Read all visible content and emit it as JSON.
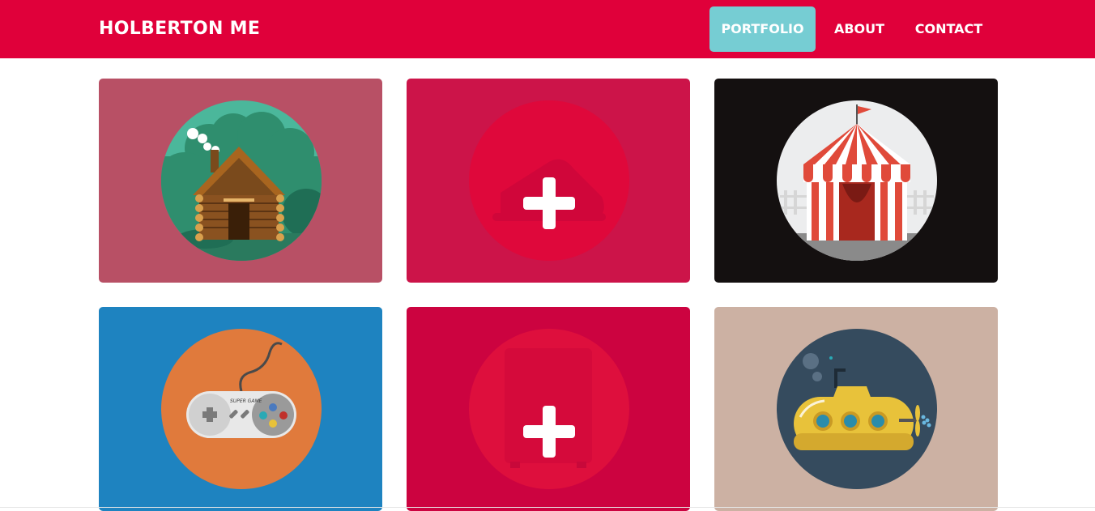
{
  "header": {
    "brand": "HOLBERTON ME",
    "nav": [
      {
        "label": "PORTFOLIO",
        "active": true
      },
      {
        "label": "ABOUT",
        "active": false
      },
      {
        "label": "CONTACT",
        "active": false
      }
    ]
  },
  "portfolio": {
    "items": [
      {
        "icon": "log-cabin-icon",
        "background": "#b85065",
        "state": "normal"
      },
      {
        "icon": "plus-icon",
        "background": "#cc1449",
        "state": "hover-overlay",
        "underlying_icon": "sneaker-icon"
      },
      {
        "icon": "circus-tent-icon",
        "background": "#141010",
        "state": "normal"
      },
      {
        "icon": "game-controller-icon",
        "background": "#1e83c0",
        "state": "normal",
        "label": "SUPER GAME"
      },
      {
        "icon": "plus-icon",
        "background": "#cc0340",
        "state": "hover-overlay",
        "underlying_icon": "safe-icon"
      },
      {
        "icon": "submarine-icon",
        "background": "#ccb1a3",
        "state": "normal"
      }
    ]
  },
  "colors": {
    "navbar": "#e0003a",
    "nav_active": "#76cdd3",
    "nav_text": "#ffffff"
  }
}
